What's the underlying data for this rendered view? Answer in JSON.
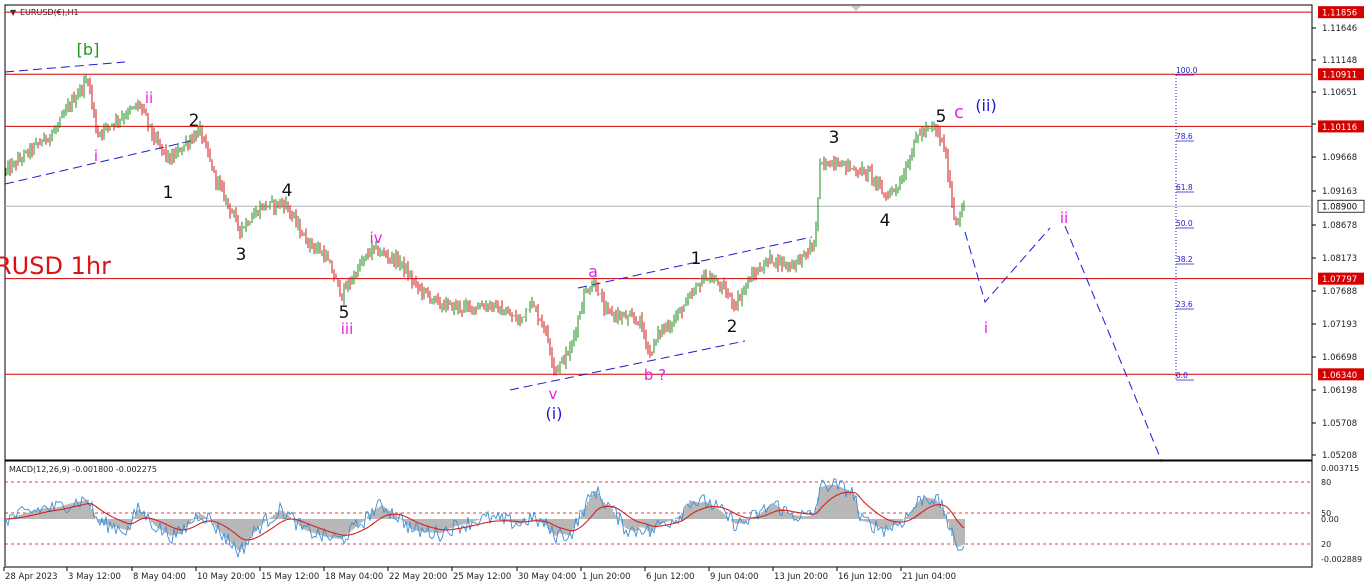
{
  "symbol_title": "EURUSD(€),H1",
  "watermark": "RUSD 1hr",
  "colors": {
    "up_candle": "#1a8c1a",
    "down_candle": "#cc1a1a",
    "hline": "#d40000",
    "trend": "#1c1ccc",
    "black_label": "#111111",
    "magenta_label": "#e61ee6",
    "green_label": "#1e9a1e",
    "macd_hist": "#b8b8b8",
    "macd_signal": "#d42020",
    "macd_line": "#3a8fd8"
  },
  "price_axis": {
    "ticks": [
      "1.11646",
      "1.11148",
      "1.10651",
      "1.10154",
      "1.09668",
      "1.09163",
      "1.08678",
      "1.08173",
      "1.07688",
      "1.07193",
      "1.06698",
      "1.06198",
      "1.05708",
      "1.05208"
    ]
  },
  "level_labels": [
    {
      "text": "1.11856",
      "price": 1.11856
    },
    {
      "text": "1.10911",
      "price": 1.10911
    },
    {
      "text": "1.10116",
      "price": 1.10116
    },
    {
      "text": "1.08900",
      "price": 1.089,
      "current": true
    },
    {
      "text": "1.07797",
      "price": 1.07797
    },
    {
      "text": "1.06340",
      "price": 1.0634
    }
  ],
  "fib_levels": [
    "100.0",
    "78.6",
    "61.8",
    "50.0",
    "38.2",
    "23.6",
    "0.0"
  ],
  "time_axis": [
    "28 Apr 2023",
    "3 May 12:00",
    "8 May 04:00",
    "10 May 20:00",
    "15 May 12:00",
    "18 May 04:00",
    "22 May 20:00",
    "25 May 12:00",
    "30 May 04:00",
    "1 Jun 20:00",
    "6 Jun 12:00",
    "9 Jun 04:00",
    "13 Jun 20:00",
    "16 Jun 12:00",
    "21 Jun 04:00"
  ],
  "wave_labels": [
    {
      "text": "[b]",
      "color": "green"
    },
    {
      "text": "ii",
      "color": "magenta"
    },
    {
      "text": "i",
      "color": "magenta"
    },
    {
      "text": "2",
      "color": "black"
    },
    {
      "text": "1",
      "color": "black"
    },
    {
      "text": "4",
      "color": "black"
    },
    {
      "text": "3",
      "color": "black"
    },
    {
      "text": "iv",
      "color": "magenta"
    },
    {
      "text": "5",
      "color": "black"
    },
    {
      "text": "iii",
      "color": "magenta"
    },
    {
      "text": "v",
      "color": "magenta"
    },
    {
      "text": "(i)",
      "color": "blue"
    },
    {
      "text": "a",
      "color": "magenta"
    },
    {
      "text": "b ?",
      "color": "magenta"
    },
    {
      "text": "1",
      "color": "black"
    },
    {
      "text": "2",
      "color": "black"
    },
    {
      "text": "3",
      "color": "black"
    },
    {
      "text": "4",
      "color": "black"
    },
    {
      "text": "5",
      "color": "black"
    },
    {
      "text": "c",
      "color": "magenta"
    },
    {
      "text": "(ii)",
      "color": "blue"
    },
    {
      "text": "i",
      "color": "magenta"
    },
    {
      "text": "ii",
      "color": "magenta"
    }
  ],
  "macd": {
    "title": "MACD(12,26,9) -0.001800 -0.002275",
    "ticks": [
      "0.003715",
      "80",
      "50",
      "0.00",
      "20",
      "-0.002889"
    ]
  },
  "chart_data": {
    "type": "candlestick",
    "instrument": "EURUSD",
    "timeframe": "H1",
    "ylim": [
      1.0505,
      1.1195
    ],
    "price_path": [
      [
        0,
        1.0935
      ],
      [
        30,
        1.0975
      ],
      [
        55,
        1.1005
      ],
      [
        70,
        1.1045
      ],
      [
        88,
        1.1085
      ],
      [
        97,
        1.1
      ],
      [
        115,
        1.102
      ],
      [
        140,
        1.1045
      ],
      [
        155,
        1.099
      ],
      [
        170,
        1.096
      ],
      [
        185,
        1.0985
      ],
      [
        200,
        1.1005
      ],
      [
        215,
        1.0935
      ],
      [
        240,
        1.0855
      ],
      [
        262,
        1.089
      ],
      [
        285,
        1.0895
      ],
      [
        305,
        1.084
      ],
      [
        325,
        1.0815
      ],
      [
        342,
        1.0755
      ],
      [
        360,
        1.08
      ],
      [
        372,
        1.0825
      ],
      [
        400,
        1.0805
      ],
      [
        415,
        1.077
      ],
      [
        440,
        1.074
      ],
      [
        465,
        1.0735
      ],
      [
        490,
        1.074
      ],
      [
        520,
        1.0715
      ],
      [
        530,
        1.0745
      ],
      [
        545,
        1.0705
      ],
      [
        555,
        1.064
      ],
      [
        570,
        1.067
      ],
      [
        585,
        1.076
      ],
      [
        595,
        1.0775
      ],
      [
        605,
        1.073
      ],
      [
        625,
        1.072
      ],
      [
        640,
        1.0715
      ],
      [
        650,
        1.0665
      ],
      [
        660,
        1.07
      ],
      [
        670,
        1.071
      ],
      [
        690,
        1.075
      ],
      [
        705,
        1.0785
      ],
      [
        720,
        1.077
      ],
      [
        735,
        1.074
      ],
      [
        750,
        1.078
      ],
      [
        770,
        1.081
      ],
      [
        790,
        1.08
      ],
      [
        805,
        1.0815
      ],
      [
        815,
        1.0835
      ],
      [
        820,
        1.095
      ],
      [
        835,
        1.096
      ],
      [
        855,
        1.0945
      ],
      [
        870,
        1.094
      ],
      [
        885,
        1.0905
      ],
      [
        900,
        1.0925
      ],
      [
        918,
        1.1
      ],
      [
        935,
        1.101
      ],
      [
        945,
        1.0975
      ],
      [
        955,
        1.0865
      ],
      [
        965,
        1.089
      ]
    ]
  }
}
